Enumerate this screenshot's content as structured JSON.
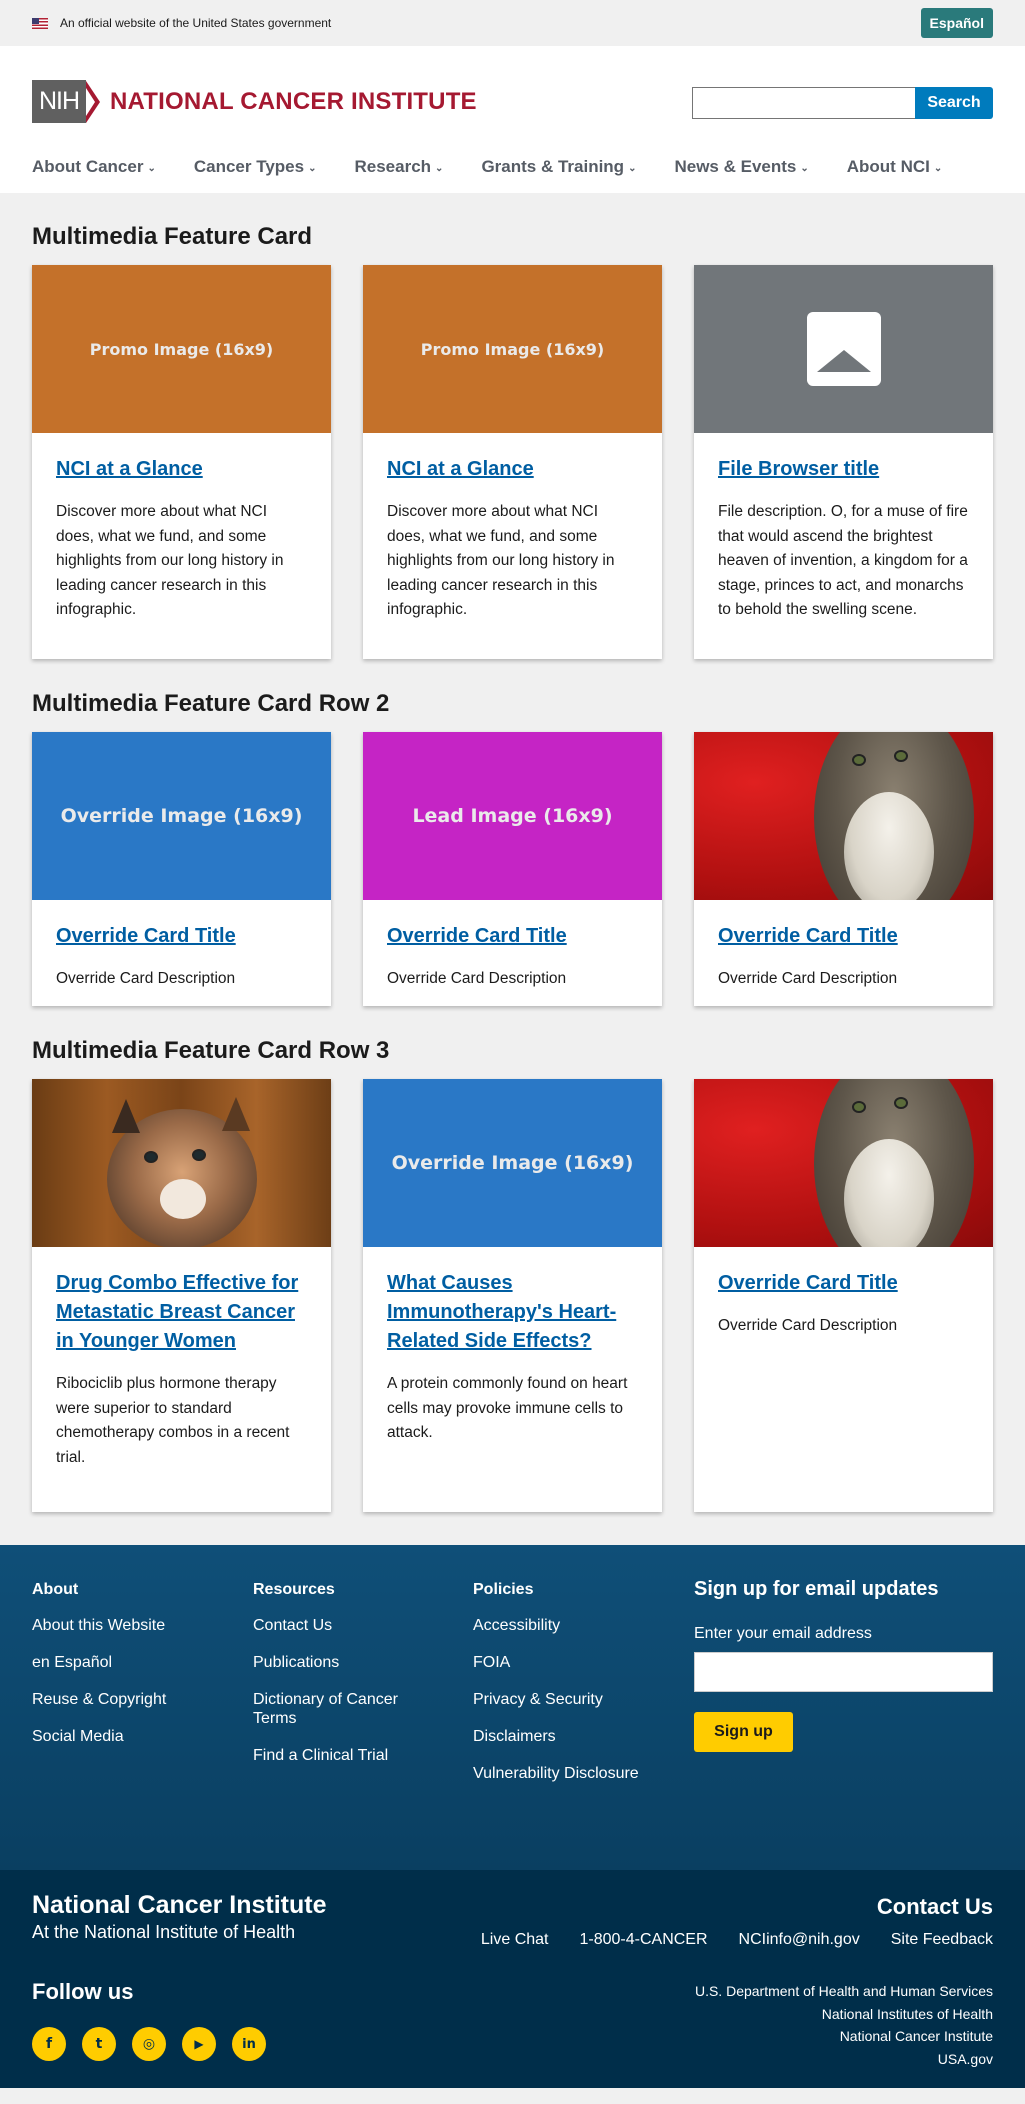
{
  "gov_banner": {
    "text": "An official website of the United States government",
    "espanol": "Español"
  },
  "header": {
    "nih": "NIH",
    "institute": "NATIONAL CANCER INSTITUTE",
    "search_button": "Search",
    "search_value": ""
  },
  "nav": [
    {
      "label": "About Cancer"
    },
    {
      "label": "Cancer Types"
    },
    {
      "label": "Research"
    },
    {
      "label": "Grants & Training"
    },
    {
      "label": "News & Events"
    },
    {
      "label": "About NCI"
    }
  ],
  "sections": [
    {
      "title": "Multimedia Feature Card",
      "cards": [
        {
          "image_label": "Promo Image (16x9)",
          "title": "NCI at a Glance",
          "desc": "Discover more about what NCI does, what we fund, and some highlights from our long history in leading cancer research in this infographic."
        },
        {
          "image_label": "Promo Image (16x9)",
          "title": "NCI at a Glance",
          "desc": "Discover more about what NCI does, what we fund, and some highlights from our long history in leading cancer research in this infographic."
        },
        {
          "image_label": "",
          "title": "File Browser title",
          "desc": "File description. O, for a muse of fire that would ascend the brightest heaven of invention, a kingdom for a stage, princes to act, and monarchs to behold the swelling scene."
        }
      ]
    },
    {
      "title": "Multimedia Feature Card Row 2",
      "cards": [
        {
          "image_label": "Override Image (16x9)",
          "title": "Override Card Title",
          "desc": "Override Card Description"
        },
        {
          "image_label": "Lead Image (16x9)",
          "title": "Override Card Title",
          "desc": "Override Card Description"
        },
        {
          "image_label": "",
          "title": "Override Card Title",
          "desc": "Override Card Description"
        }
      ]
    },
    {
      "title": "Multimedia Feature Card Row 3",
      "cards": [
        {
          "image_label": "",
          "title": "Drug Combo Effective for Metastatic Breast Cancer in Younger Women",
          "desc": "Ribociclib plus hormone therapy were superior to standard chemotherapy combos in a recent trial."
        },
        {
          "image_label": "Override Image (16x9)",
          "title": "What Causes Immunotherapy's Heart-Related Side Effects?",
          "desc": "A protein commonly found on heart cells may provoke immune cells to attack."
        },
        {
          "image_label": "",
          "title": "Override Card Title",
          "desc": "Override Card Description"
        }
      ]
    }
  ],
  "footer": {
    "about": {
      "heading": "About",
      "links": [
        "About this Website",
        "en Español",
        "Reuse & Copyright",
        "Social Media"
      ]
    },
    "resources": {
      "heading": "Resources",
      "links": [
        "Contact Us",
        "Publications",
        "Dictionary of Cancer Terms",
        "Find a Clinical Trial"
      ]
    },
    "policies": {
      "heading": "Policies",
      "links": [
        "Accessibility",
        "FOIA",
        "Privacy & Security",
        "Disclaimers",
        "Vulnerability Disclosure"
      ]
    },
    "signup": {
      "heading": "Sign up for email updates",
      "label": "Enter your email address",
      "button": "Sign up"
    },
    "bottom": {
      "name": "National Cancer Institute",
      "sub": "At the National Institute of Health",
      "follow": "Follow us",
      "contact_heading": "Contact Us",
      "contact_links": [
        "Live Chat",
        "1-800-4-CANCER",
        "NCIinfo@nih.gov",
        "Site Feedback"
      ],
      "gov_links": [
        "U.S. Department of Health and Human Services",
        "National Institutes of Health",
        "National Cancer Institute",
        "USA.gov"
      ],
      "socials": [
        {
          "icon": "facebook-icon",
          "glyph": "f"
        },
        {
          "icon": "twitter-icon",
          "glyph": "t"
        },
        {
          "icon": "instagram-icon",
          "glyph": "◎"
        },
        {
          "icon": "youtube-icon",
          "glyph": "▶"
        },
        {
          "icon": "linkedin-icon",
          "glyph": "in"
        }
      ]
    }
  },
  "colors": {
    "accent_red": "#a51931",
    "link_blue": "#005ea2",
    "footer_blue": "#0f4f78",
    "footer_dark": "#002e4a",
    "yellow": "#ffcc00",
    "promo_orange": "#c4712a",
    "override_blue": "#2a78c6",
    "lead_magenta": "#c524c5"
  }
}
